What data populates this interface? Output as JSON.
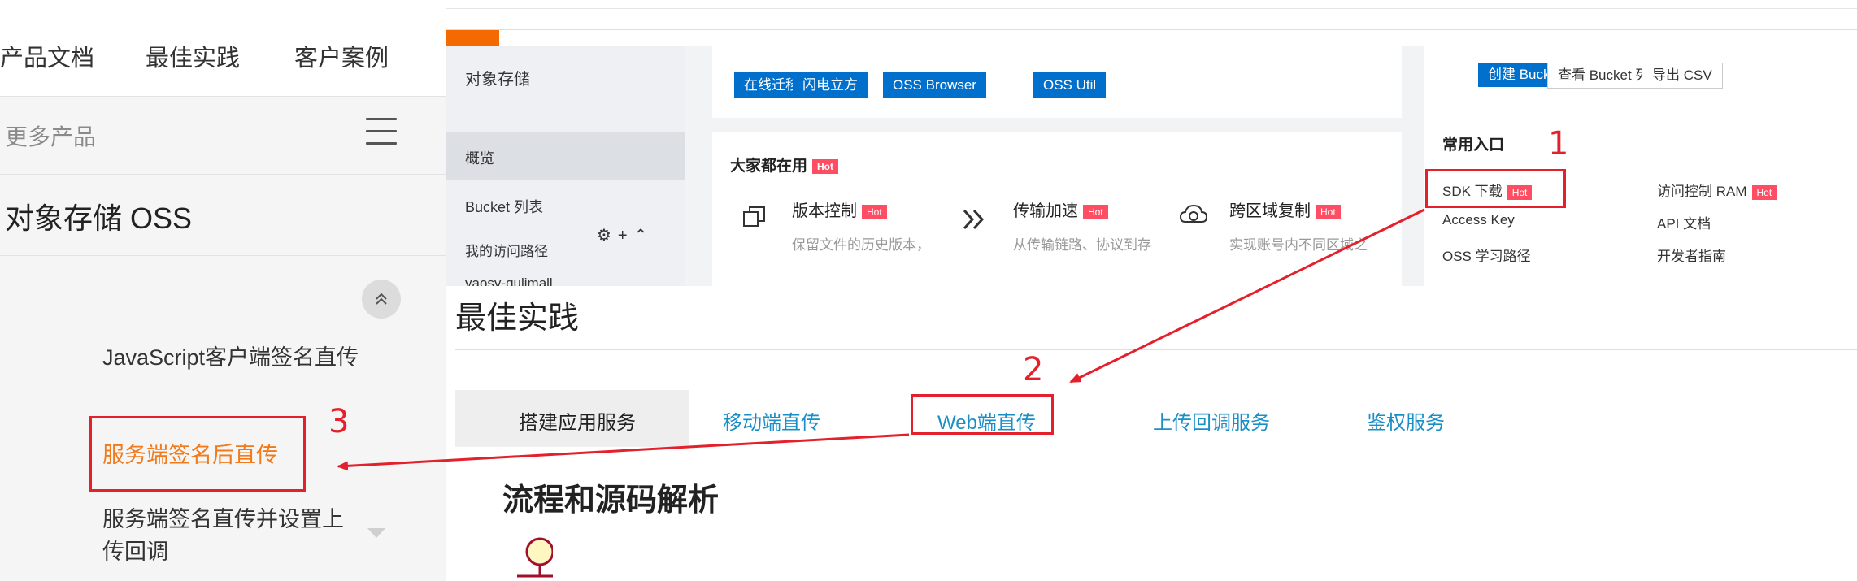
{
  "doc_nav": {
    "items": [
      "产品文档",
      "最佳实践",
      "客户案例"
    ]
  },
  "more_products": "更多产品",
  "oss_title": "对象存储 OSS",
  "doc_links": [
    "JavaScript客户端签名直传",
    "服务端签名后直传",
    "服务端签名直传并设置上传回调"
  ],
  "console": {
    "sidebar": {
      "title": "对象存储",
      "overview": "概览",
      "bucket_list": "Bucket 列表",
      "my_paths": "我的访问路径",
      "path_icons": "⚙+⌃",
      "bucket_name": "yaosy-gulimall"
    },
    "tools": [
      "在线迁移",
      "闪电立方",
      "OSS Browser",
      "OSS Util"
    ],
    "bucket_actions": {
      "create": "创建 Bucket",
      "view": "查看 Bucket 列表",
      "export": "导出 CSV"
    },
    "popular": {
      "title": "大家都在用",
      "hot": "Hot",
      "features": [
        {
          "name": "版本控制",
          "desc": "保留文件的历史版本，",
          "icon": "copy-icon"
        },
        {
          "name": "传输加速",
          "desc": "从传输链路、协议到存",
          "icon": "double-chevron-icon"
        },
        {
          "name": "跨区域复制",
          "desc": "实现账号内不同区域之",
          "icon": "cloud-sync-icon"
        }
      ]
    },
    "common_entries": {
      "title": "常用入口",
      "col1": [
        "SDK 下载",
        "Access Key",
        "OSS 学习路径"
      ],
      "col2": [
        "访问控制 RAM",
        "API 文档",
        "开发者指南"
      ]
    }
  },
  "best_practice": {
    "title": "最佳实践",
    "tabs": [
      "搭建应用服务",
      "移动端直传",
      "Web端直传",
      "上传回调服务",
      "鉴权服务"
    ],
    "active_tab": 0
  },
  "flow_title": "流程和源码解析",
  "annotations": {
    "n1": "1",
    "n2": "2",
    "n3": "3"
  },
  "colors": {
    "accent_orange": "#f07a1c",
    "annotation_red": "#e3202b",
    "link_blue": "#1a8fc6",
    "console_blue": "#0070cc",
    "hot_badge": "#ff4d63"
  }
}
